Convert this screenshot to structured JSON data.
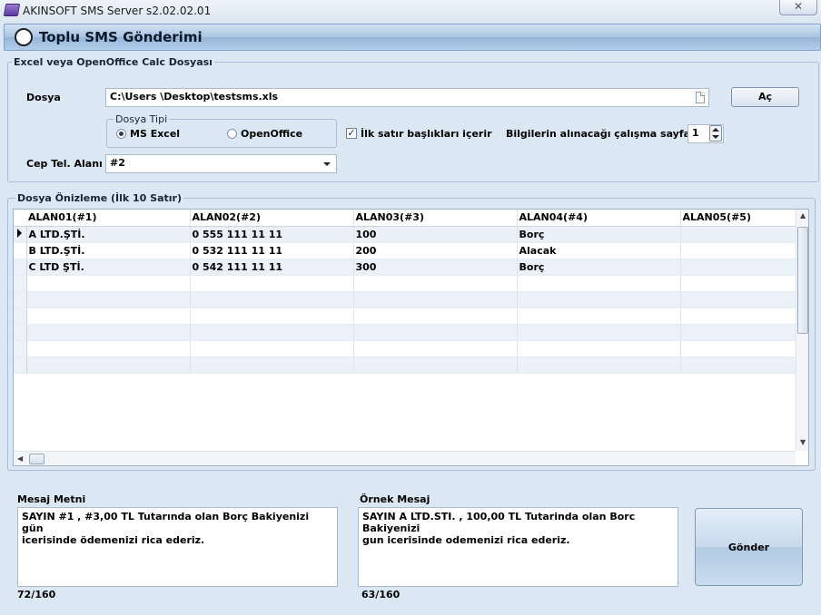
{
  "window": {
    "title": "AKINSOFT SMS Server s2.02.02.01",
    "close_glyph": "✕"
  },
  "header": {
    "title": "Toplu SMS Gönderimi"
  },
  "file_group": {
    "caption": "Excel veya OpenOffice Calc Dosyası",
    "file_label": "Dosya",
    "file_path": "C:\\Users \\Desktop\\testsms.xls",
    "open_button": "Aç",
    "file_type_caption": "Dosya Tipi",
    "ms_excel": "MS Excel",
    "openoffice": "OpenOffice",
    "selected_type": "MS Excel",
    "first_row_headers_label": "İlk satır başlıkları içerir",
    "first_row_headers_checked": true,
    "sheet_label": "Bilgilerin alınacağı çalışma sayfası",
    "sheet_value": "1",
    "phone_field_label": "Cep Tel. Alanı",
    "phone_field_value": "#2"
  },
  "preview": {
    "caption": "Dosya Önizleme (İlk 10 Satır)",
    "columns": [
      "ALAN01(#1)",
      "ALAN02(#2)",
      "ALAN03(#3)",
      "ALAN04(#4)",
      "ALAN05(#5)"
    ],
    "rows": [
      [
        "A LTD.ŞTİ.",
        "0 555 111 11 11",
        "100",
        "Borç",
        ""
      ],
      [
        "B LTD.ŞTİ.",
        "0 532 111 11 11",
        "200",
        "Alacak",
        ""
      ],
      [
        "C LTD ŞTİ.",
        "0 542 111 11 11",
        "300",
        "Borç",
        ""
      ]
    ]
  },
  "message": {
    "label": "Mesaj Metni",
    "text": "SAYIN #1 , #3,00 TL Tutarında olan Borç Bakiyenizi gün\nicerisinde ödemenizi rica ederiz.",
    "count": "72/160"
  },
  "sample": {
    "label": "Örnek Mesaj",
    "text": "SAYIN A LTD.STI. , 100,00 TL Tutarinda olan Borc Bakiyenizi\ngun icerisinde odemenizi rica ederiz.",
    "count": "63/160"
  },
  "send_button": "Gönder",
  "colors": {
    "background": "#dbe7f3",
    "header_gradient": "#a8c4e2",
    "row_alt": "#eaf1f9"
  }
}
